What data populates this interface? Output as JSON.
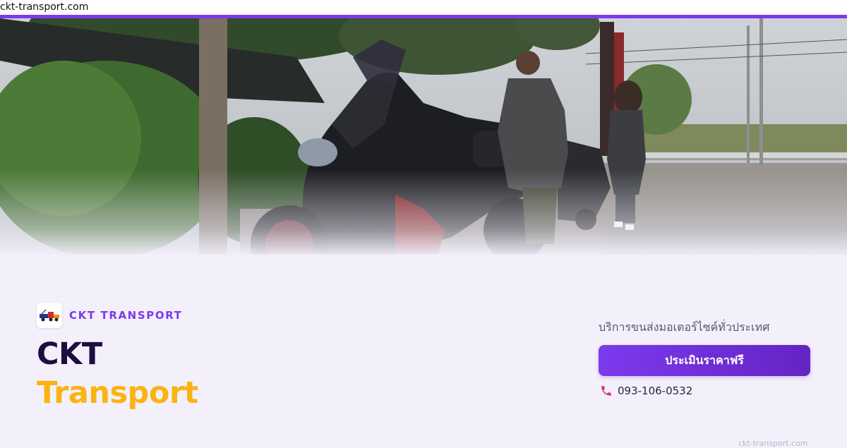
{
  "browser": {
    "url": "ckt-transport.com"
  },
  "colors": {
    "accent": "#7c3aed",
    "brand_yellow": "#fbb311",
    "title_dark": "#1c0f3f",
    "background": "#f3f0fb"
  },
  "hero": {
    "image_subject": "black sport motorcycle parked roadside with two people"
  },
  "brand": {
    "logo_icon": "tow-truck-icon",
    "name": "CKT TRANSPORT"
  },
  "headline": {
    "line1": "CKT",
    "line2": "Transport"
  },
  "side": {
    "tagline": "บริการขนส่งมอเตอร์ไซค์ทั่วประเทศ",
    "cta_label": "ประเมินราคาฟรี",
    "phone_icon": "phone-icon",
    "phone": "093-106-0532"
  },
  "footer": {
    "domain": "ckt-transport.com"
  }
}
